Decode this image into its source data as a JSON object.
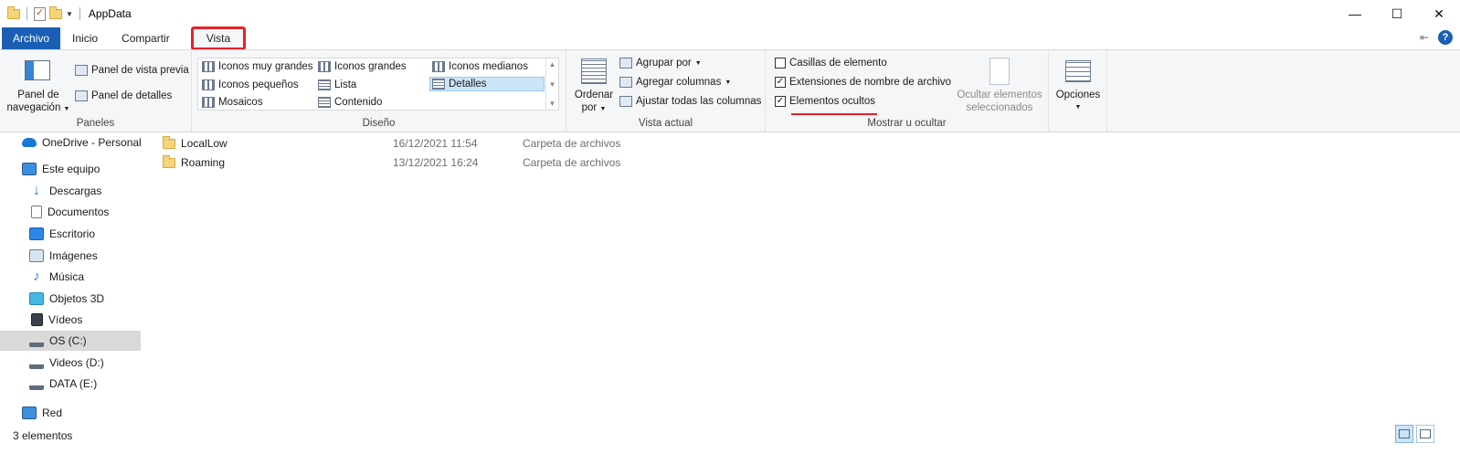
{
  "window": {
    "title": "AppData",
    "controls": {
      "minimize": "—",
      "maximize": "☐",
      "close": "✕"
    }
  },
  "tabs": [
    {
      "label": "Archivo"
    },
    {
      "label": "Inicio"
    },
    {
      "label": "Compartir"
    },
    {
      "label": "Vista"
    }
  ],
  "ribbon": {
    "panes": {
      "nav_pane_line1": "Panel de",
      "nav_pane_line2": "navegación",
      "preview_pane": "Panel de vista previa",
      "details_pane": "Panel de detalles",
      "group_label": "Paneles"
    },
    "layout": {
      "items": [
        "Iconos muy grandes",
        "Iconos grandes",
        "Iconos medianos",
        "Iconos pequeños",
        "Lista",
        "Detalles",
        "Mosaicos",
        "Contenido"
      ],
      "selected": "Detalles",
      "group_label": "Diseño"
    },
    "current_view": {
      "sort_line1": "Ordenar",
      "sort_line2": "por",
      "group_by": "Agrupar por",
      "add_columns": "Agregar columnas",
      "fit_columns": "Ajustar todas las columnas",
      "group_label": "Vista actual"
    },
    "show_hide": {
      "item_checkboxes": {
        "label": "Casillas de elemento",
        "checked": false
      },
      "file_extensions": {
        "label": "Extensiones de nombre de archivo",
        "checked": true
      },
      "hidden_items": {
        "label": "Elementos ocultos",
        "checked": true
      },
      "hide_selected_line1": "Ocultar elementos",
      "hide_selected_line2": "seleccionados",
      "group_label": "Mostrar u ocultar"
    },
    "options": {
      "label": "Opciones"
    }
  },
  "nav": {
    "items": [
      {
        "label": "OneDrive - Personal",
        "icon": "onedrive-icon"
      },
      {
        "label": "Este equipo",
        "icon": "pc-icon"
      },
      {
        "label": "Descargas",
        "icon": "download-icon"
      },
      {
        "label": "Documentos",
        "icon": "documents-icon"
      },
      {
        "label": "Escritorio",
        "icon": "desktop-icon"
      },
      {
        "label": "Imágenes",
        "icon": "pictures-icon"
      },
      {
        "label": "Música",
        "icon": "music-icon"
      },
      {
        "label": "Objetos 3D",
        "icon": "3d-objects-icon"
      },
      {
        "label": "Vídeos",
        "icon": "videos-icon"
      },
      {
        "label": "OS (C:)",
        "icon": "drive-icon"
      },
      {
        "label": "Videos (D:)",
        "icon": "drive-icon"
      },
      {
        "label": "DATA (E:)",
        "icon": "drive-icon"
      },
      {
        "label": "Red",
        "icon": "network-icon"
      }
    ],
    "selected": "OS (C:)"
  },
  "files": [
    {
      "name": "LocalLow",
      "date": "16/12/2021 11:54",
      "type": "Carpeta de archivos"
    },
    {
      "name": "Roaming",
      "date": "13/12/2021 16:24",
      "type": "Carpeta de archivos"
    }
  ],
  "status": {
    "count": "3 elementos"
  },
  "colors": {
    "accent": "#1a5fb4",
    "highlight": "#e8202a",
    "selection": "#cce4f7"
  }
}
